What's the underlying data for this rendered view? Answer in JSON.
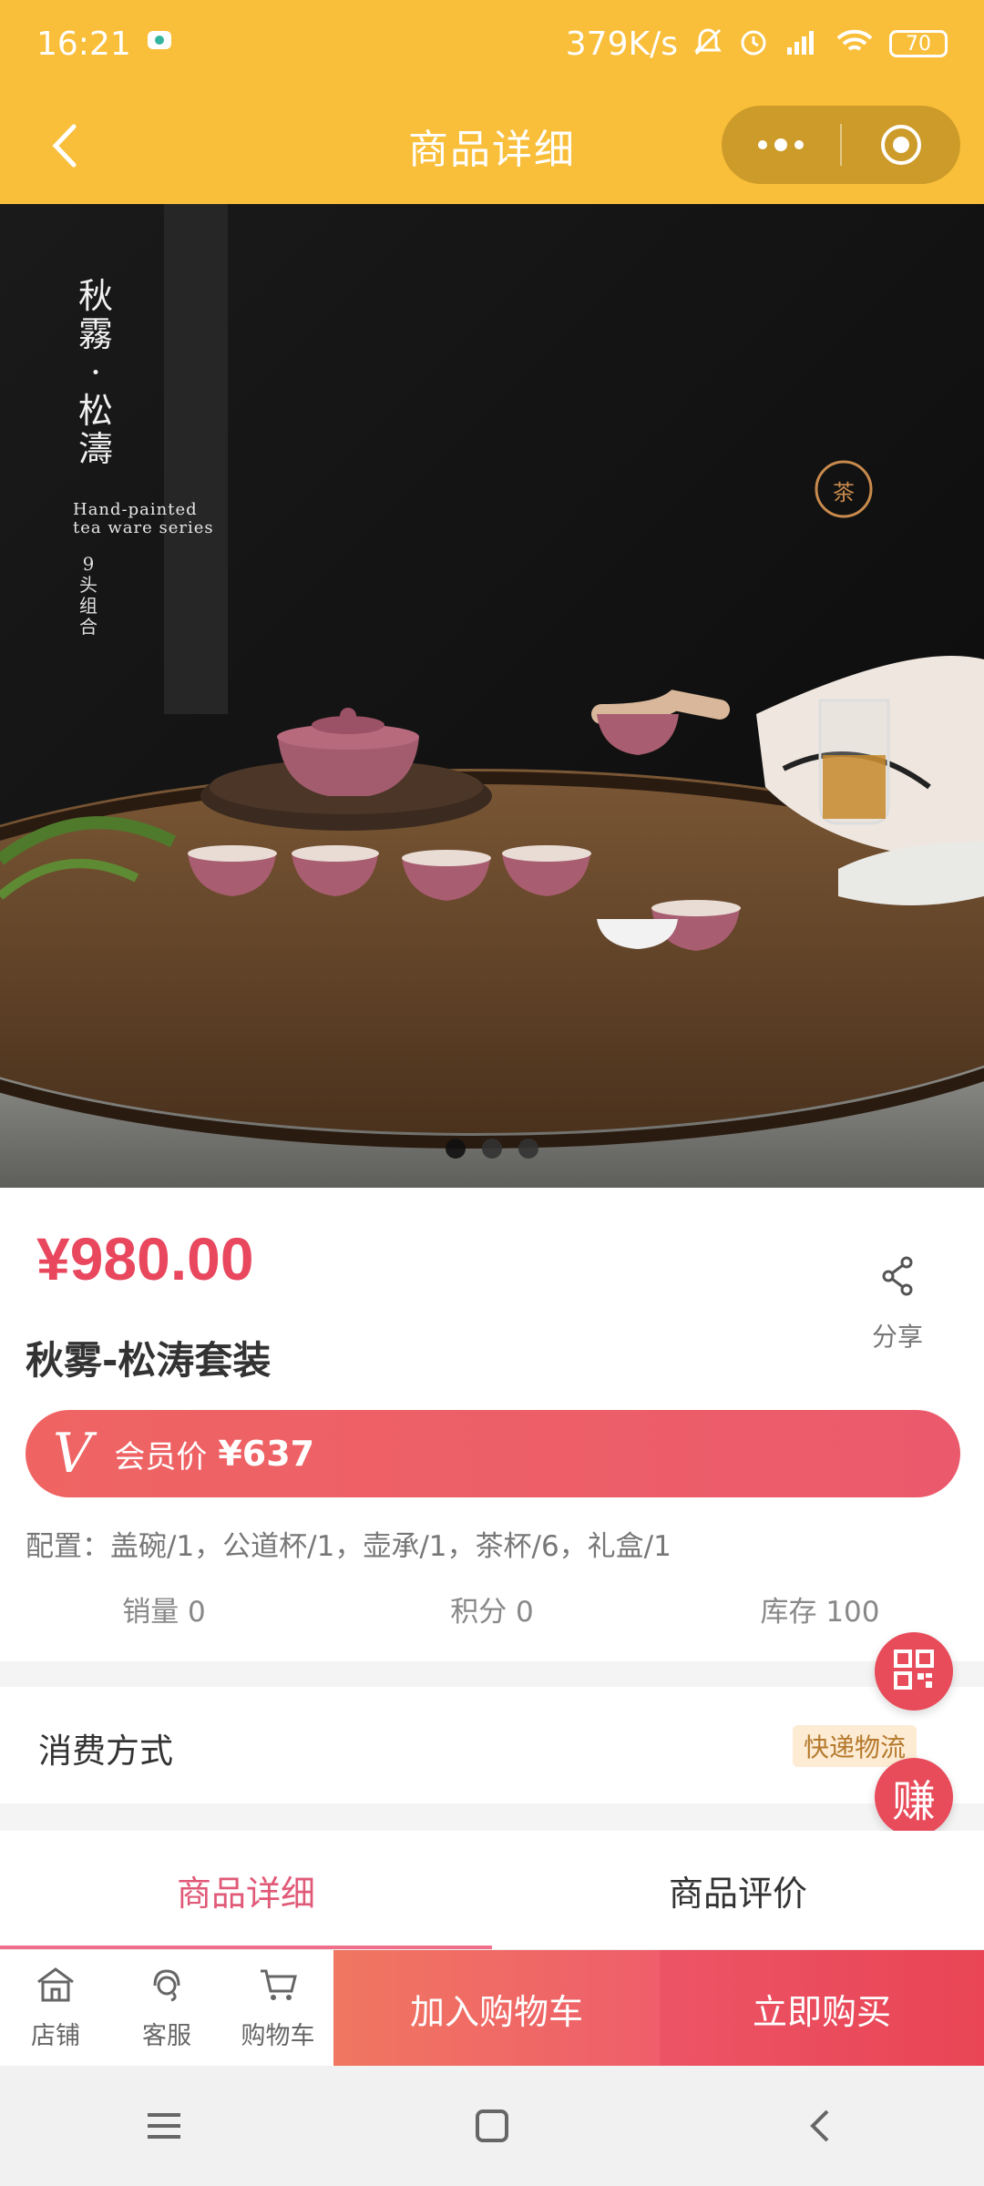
{
  "status_bar": {
    "time": "16:21",
    "network_speed": "379K/s",
    "battery": "70",
    "icons": [
      "chat-notification-icon",
      "mute-icon",
      "alarm-icon",
      "hd-signal-icon",
      "wifi-icon",
      "battery-icon"
    ]
  },
  "nav": {
    "title": "商品详细",
    "back_icon": "back-arrow-icon",
    "more_icon": "more-dots-icon",
    "close_icon": "target-close-icon"
  },
  "banner": {
    "vertical_title_lines": [
      "秋",
      "霧",
      "·",
      "松",
      "濤"
    ],
    "subtitle_line1": "Hand-painted",
    "subtitle_line2": "tea ware series",
    "set_count_lines": [
      "9",
      "头",
      "组",
      "合"
    ],
    "seal_text": "茶",
    "slide_count": 3,
    "active_slide": 0
  },
  "product": {
    "price": "¥980.00",
    "title": "秋雾-松涛套装",
    "share_label": "分享",
    "member_badge": "V",
    "member_label": "会员价",
    "member_price": "¥637",
    "config": "配置：盖碗/1，公道杯/1，壶承/1，茶杯/6，礼盒/1",
    "stats": {
      "sales": "销量 0",
      "points": "积分 0",
      "stock": "库存 100"
    }
  },
  "consume": {
    "label": "消费方式",
    "badge": "快递物流"
  },
  "float": {
    "qr_icon": "qr-code-icon",
    "earn_label": "赚"
  },
  "tabs": {
    "detail": "商品详细",
    "reviews": "商品评价"
  },
  "bottom_bar": {
    "shop": "店铺",
    "service": "客服",
    "cart": "购物车",
    "add_to_cart": "加入购物车",
    "buy_now": "立即购买"
  },
  "colors": {
    "header": "#f9bf3b",
    "accent": "#e8475d",
    "tab_active": "#e05a78"
  }
}
